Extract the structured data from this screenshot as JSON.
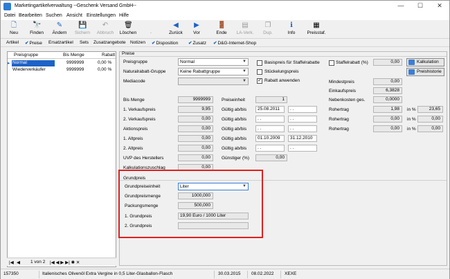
{
  "window": {
    "title": "Marketingartikelverwaltung  --Geschenk Versand GmbH--",
    "min": "—",
    "max": "☐",
    "close": "✕"
  },
  "menu": [
    "Datei",
    "Bearbeiten",
    "Suchen",
    "Ansicht",
    "Einstellungen",
    "Hilfe"
  ],
  "toolbar": [
    {
      "label": "Neu",
      "icon": "new-icon",
      "glyph": "🗋",
      "enabled": true
    },
    {
      "label": "Finden",
      "icon": "binoculars-icon",
      "glyph": "🔭",
      "enabled": true
    },
    {
      "label": "Ändern",
      "icon": "pencil-icon",
      "glyph": "✎",
      "enabled": true
    },
    {
      "label": "Sichern",
      "icon": "save-icon",
      "glyph": "💾",
      "enabled": false
    },
    {
      "label": "Abbruch",
      "icon": "undo-icon",
      "glyph": "↶",
      "enabled": false
    },
    {
      "label": "Löschen",
      "icon": "delete-icon",
      "glyph": "🗑",
      "enabled": true
    },
    {
      "label": "-",
      "icon": "blank-icon",
      "glyph": "",
      "enabled": false
    },
    {
      "label": "Zurück",
      "icon": "arrow-left-icon",
      "glyph": "◀",
      "enabled": true
    },
    {
      "label": "Vor",
      "icon": "arrow-right-icon",
      "glyph": "▶",
      "enabled": true
    },
    {
      "label": "Ende",
      "icon": "exit-door-icon",
      "glyph": "🚪",
      "enabled": true
    },
    {
      "label": "LA-Verk.",
      "icon": "la-verk-icon",
      "glyph": "▤",
      "enabled": false
    },
    {
      "label": "Dup.",
      "icon": "duplicate-icon",
      "glyph": "❐",
      "enabled": false
    },
    {
      "label": "Info",
      "icon": "info-icon",
      "glyph": "ℹ",
      "enabled": true
    },
    {
      "label": "Preisstaf.",
      "icon": "price-scale-icon",
      "glyph": "▦",
      "enabled": true
    }
  ],
  "tabs": [
    {
      "label": "Artikel",
      "checked": false
    },
    {
      "label": "Preise",
      "checked": true
    },
    {
      "label": "Ersatzartikel",
      "checked": false
    },
    {
      "label": "Sets",
      "checked": false
    },
    {
      "label": "Zusatzangebote",
      "checked": false
    },
    {
      "label": "Notizen",
      "checked": false
    },
    {
      "label": "Disposition",
      "checked": true
    },
    {
      "label": "Zusatz",
      "checked": true
    },
    {
      "label": "D&G-Internet-Shop",
      "checked": false
    }
  ],
  "grid": {
    "headers": [
      "Preisgruppe",
      "Bis Menge",
      "Rabatt"
    ],
    "rows": [
      {
        "group": "Normal",
        "qty": "9999999",
        "discount": "0,00 %"
      },
      {
        "group": "Wiederverkäufer",
        "qty": "9999999",
        "discount": "0,00 %"
      }
    ],
    "pager": {
      "text": "1 von 2",
      "nav": "|◀ ◀ ▶ ▶| ✱ ✕"
    }
  },
  "preise": {
    "section": "Preise",
    "preisgruppe_label": "Preisgruppe",
    "preisgruppe": "Normal",
    "naturalrabatt_label": "Naturalrabatt-Gruppe",
    "naturalrabatt": "Keine Rabattgruppe",
    "mediacode_label": "Mediacode",
    "mediacode": "",
    "basispreis_label": "Basispreis für Staffelrabatte",
    "stueckelung_label": "Stückelungspreis",
    "rabatt_label": "Rabatt anwenden",
    "staffelrabatt_label": "Staffelrabatt (%)",
    "staffelrabatt": "0,00",
    "kalkulation_btn": "Kalkulation",
    "preishistorie_btn": "Preishistorie",
    "mindestpreis_label": "Mindestpreis",
    "mindestpreis": "0,00",
    "einkaufspreis_label": "Einkaufspreis",
    "einkaufspreis": "6,3828",
    "nebenkosten_label": "Nebenkosten ges.",
    "nebenkosten": "0,0000",
    "rows": [
      {
        "label": "Bis Menge",
        "value": "9999999"
      },
      {
        "label": "1. Verkaufspreis",
        "value": "9,95"
      },
      {
        "label": "2. Verkaufspreis",
        "value": "0,00"
      },
      {
        "label": "Aktionspreis",
        "value": "0,00"
      },
      {
        "label": "1. Altpreis",
        "value": "0,00"
      },
      {
        "label": "2. Altpreis",
        "value": "0,00"
      },
      {
        "label": "UVP des Herstellers",
        "value": "0,00"
      },
      {
        "label": "Kalkulationszuschlag",
        "value": "0,00"
      }
    ],
    "preiseinheit_label": "Preiseinheit",
    "preiseinheit": "1",
    "gueltig": [
      {
        "label": "Gültig ab/bis",
        "from": "25.08.2011",
        "to": ". ."
      },
      {
        "label": "Gültig ab/bis",
        "from": ". .",
        "to": ". ."
      },
      {
        "label": "Gültig ab/bis",
        "from": ". .",
        "to": ". ."
      },
      {
        "label": "Gültig ab/bis",
        "from": "01.10.2009",
        "to": "31.12.2010"
      },
      {
        "label": "Gültig ab/bis",
        "from": ". .",
        "to": ". ."
      }
    ],
    "guenstiger_label": "Günstiger (%)",
    "guenstiger": "0,00",
    "rohertrag": [
      {
        "label": "Rohertrag",
        "value": "1,98",
        "pct_label": "in %",
        "pct": "23,65"
      },
      {
        "label": "Rohertrag",
        "value": "0,00",
        "pct_label": "in %",
        "pct": "0,00"
      },
      {
        "label": "Rohertrag",
        "value": "0,00",
        "pct_label": "in %",
        "pct": "0,00"
      }
    ]
  },
  "grundpreis": {
    "section": "Grundpreis",
    "einheit_label": "Grundpreiseinheit",
    "einheit": "Liter",
    "menge_label": "Grundpreismenge",
    "menge": "1000,000",
    "packung_label": "Packungsmenge",
    "packung": "500,000",
    "gp1_label": "1. Grundpreis",
    "gp1": "19,90 Euro / 1000 Liter",
    "gp2_label": "2. Grundpreis",
    "gp2": ""
  },
  "status": {
    "id": "157350",
    "desc": "Italienisches Olivenöl Extra Vergine in 0,5 Liter-Glasballon-Flasch",
    "date1": "30.03.2015",
    "date2": "08.02.2022",
    "user": "XEXE"
  },
  "colors": {
    "accent": "#1e62c7",
    "highlight": "#e0201e"
  }
}
